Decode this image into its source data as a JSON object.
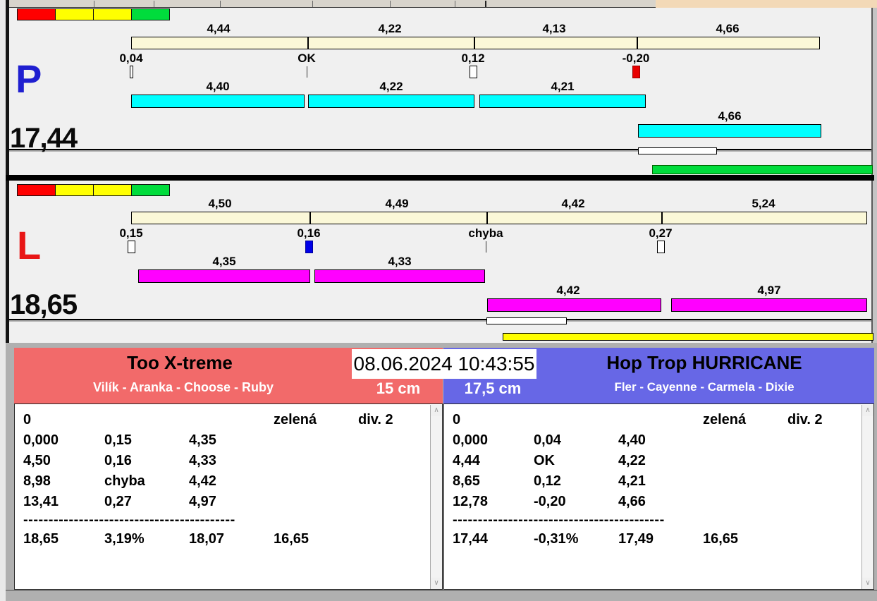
{
  "top_bar": {
    "tan_color": "#f3d9b7"
  },
  "lights": {
    "colors": [
      "#ff0000",
      "#ffff00",
      "#ffff00",
      "#00dc3c"
    ]
  },
  "p_run": {
    "letter": "P",
    "total": "17,44",
    "splits": [
      "4,44",
      "4,22",
      "4,13",
      "4,66"
    ],
    "crossings": [
      "0,04",
      "OK",
      "0,12",
      "-0,20"
    ],
    "dog_times": [
      "4,40",
      "4,22",
      "4,21",
      "4,66"
    ]
  },
  "l_run": {
    "letter": "L",
    "total": "18,65",
    "splits": [
      "4,50",
      "4,49",
      "4,42",
      "5,24"
    ],
    "crossings": [
      "0,15",
      "0,16",
      "chyba",
      "0,27"
    ],
    "dog_times": [
      "4,35",
      "4,33",
      "4,42",
      "4,97"
    ]
  },
  "datetime": "08.06.2024 10:43:55",
  "left_team": {
    "name": "Too X-treme",
    "dogs": "Vilík - Aranka - Choose - Ruby",
    "jump_height": "15 cm",
    "header_color": "#f26a6a",
    "table": {
      "first_row": {
        "num": "0",
        "color_word": "zelená",
        "division": "div. 2"
      },
      "rows": [
        [
          "0,000",
          "0,15",
          "4,35"
        ],
        [
          "4,50",
          "0,16",
          "4,33"
        ],
        [
          "8,98",
          "chyba",
          "4,42"
        ],
        [
          "13,41",
          "0,27",
          "4,97"
        ]
      ],
      "dashes": "------------------------------------------",
      "total_row": [
        "18,65",
        "3,19%",
        "18,07",
        "16,65"
      ]
    }
  },
  "right_team": {
    "name": "Hop Trop HURRICANE",
    "dogs": "Fler - Cayenne - Carmela - Dixie",
    "jump_height": "17,5 cm",
    "header_color": "#6767e6",
    "table": {
      "first_row": {
        "num": "0",
        "color_word": "zelená",
        "division": "div. 2"
      },
      "rows": [
        [
          "0,000",
          "0,04",
          "4,40"
        ],
        [
          "4,44",
          "OK",
          "4,22"
        ],
        [
          "8,65",
          "0,12",
          "4,21"
        ],
        [
          "12,78",
          "-0,20",
          "4,66"
        ]
      ],
      "dashes": "------------------------------------------",
      "total_row": [
        "17,44",
        "-0,31%",
        "17,49",
        "16,65"
      ]
    }
  },
  "icons": {
    "scroll_up": "∧",
    "scroll_down": "∨"
  },
  "colors": {
    "split_bar": "#fbf8d8",
    "p_dog_bar": "#00ffff",
    "l_dog_bar": "#ff00ff",
    "p_letter": "#1f1fd0",
    "l_letter": "#e81515",
    "marker_red": "#e80000",
    "marker_blue": "#0000e8",
    "progress_green": "#00dc3c",
    "progress_yellow": "#ffff00"
  }
}
